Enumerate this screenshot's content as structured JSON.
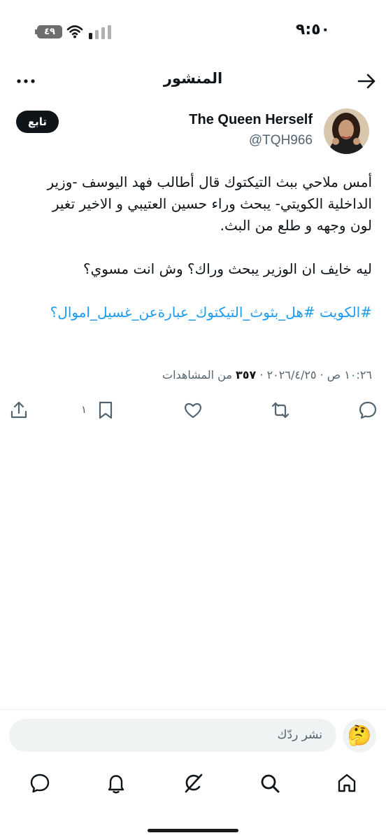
{
  "status_bar": {
    "time": "٩:٥٠",
    "battery": "٤٩"
  },
  "header": {
    "title": "المنشور"
  },
  "author": {
    "name": "The Queen Herself",
    "handle": "@TQH966",
    "follow_label": "تابع"
  },
  "post": {
    "lines": [
      "أمس ملاحي ببث التيكتوك قال أطالب فهد اليوسف -وزير",
      "الداخلية الكويتي- يبحث وراء حسين العتيبي و الاخير تغير",
      "لون وجهه و طلع من البث."
    ],
    "question": "ليه خايف ان الوزير يبحث وراك؟ وش انت مسوي؟",
    "hashtags": "#الكويت #هل_بثوث_التيكتوك_عبارةعن_غسيل_اموال؟"
  },
  "meta": {
    "date": "٢٠٢٦/٤/٢٥",
    "time": "١٠:٢٦ ص",
    "views_count": "٣٥٧",
    "views_label": "من المشاهدات",
    "separator": "·"
  },
  "actions": {
    "bookmark_count": "١",
    "icons": [
      "reply-icon",
      "repost-icon",
      "like-icon",
      "bookmark-icon",
      "share-icon"
    ]
  },
  "composer": {
    "placeholder": "نشر ردّك",
    "emoji": "🤔"
  },
  "bottom_nav": {
    "items": [
      "home-icon",
      "search-icon",
      "grok-icon",
      "notifications-icon",
      "messages-icon"
    ]
  },
  "colors": {
    "link": "#1d9bf0",
    "text": "#0f1419",
    "secondary": "#536471",
    "input_bg": "#eff3f4"
  }
}
